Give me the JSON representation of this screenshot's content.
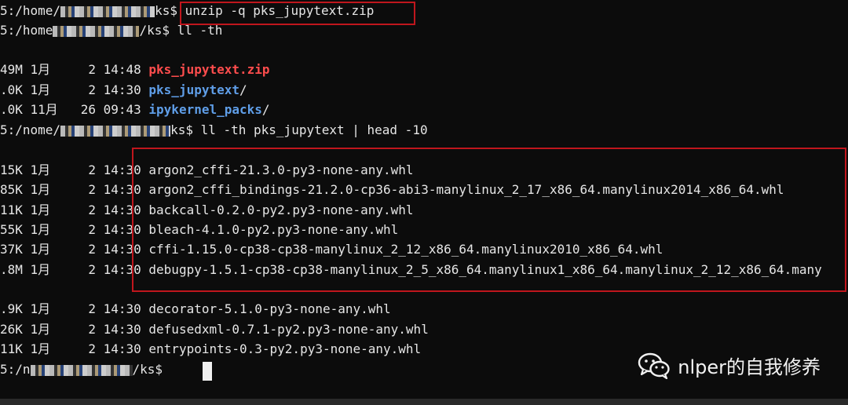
{
  "terminal": {
    "lines": [
      {
        "prefix": "5:/home/",
        "masked": "",
        "suffix": "ks$ ",
        "cmd": "unzip -q pks_jupytext.zip"
      },
      {
        "prefix": "5:/home",
        "masked": "",
        "suffix": "/ks$ ",
        "cmd": "ll -th"
      },
      {
        "blank": true
      },
      {
        "size": "49M",
        "month": "1月",
        "day": " 2",
        "time": "14:48",
        "name": "pks_jupytext.zip",
        "kind": "zip"
      },
      {
        "size": ".0K",
        "month": "1月",
        "day": " 2",
        "time": "14:30",
        "name": "pks_jupytext",
        "kind": "dir",
        "slash": "/"
      },
      {
        "size": ".0K",
        "month": "11月",
        "day": "26",
        "time": "09:43",
        "name": "ipykernel_packs",
        "kind": "dir",
        "slash": "/"
      },
      {
        "prefix": "5:/nome/",
        "masked": "",
        "suffix": "ks$ ",
        "cmd": "ll -th pks_jupytext | head -10"
      },
      {
        "blank": true
      },
      {
        "size": "15K",
        "month": "1月",
        "day": " 2",
        "time": "14:30",
        "name": "argon2_cffi-21.3.0-py3-none-any.whl"
      },
      {
        "size": "85K",
        "month": "1月",
        "day": " 2",
        "time": "14:30",
        "name": "argon2_cffi_bindings-21.2.0-cp36-abi3-manylinux_2_17_x86_64.manylinux2014_x86_64.whl"
      },
      {
        "size": "11K",
        "month": "1月",
        "day": " 2",
        "time": "14:30",
        "name": "backcall-0.2.0-py2.py3-none-any.whl"
      },
      {
        "size": "55K",
        "month": "1月",
        "day": " 2",
        "time": "14:30",
        "name": "bleach-4.1.0-py2.py3-none-any.whl"
      },
      {
        "size": "37K",
        "month": "1月",
        "day": " 2",
        "time": "14:30",
        "name": "cffi-1.15.0-cp38-cp38-manylinux_2_12_x86_64.manylinux2010_x86_64.whl"
      },
      {
        "size": ".8M",
        "month": "1月",
        "day": " 2",
        "time": "14:30",
        "name": "debugpy-1.5.1-cp38-cp38-manylinux_2_5_x86_64.manylinux1_x86_64.manylinux_2_12_x86_64.many"
      },
      {
        "blank": true
      },
      {
        "size": ".9K",
        "month": "1月",
        "day": " 2",
        "time": "14:30",
        "name": "decorator-5.1.0-py3-none-any.whl"
      },
      {
        "size": "26K",
        "month": "1月",
        "day": " 2",
        "time": "14:30",
        "name": "defusedxml-0.7.1-py2.py3-none-any.whl"
      },
      {
        "size": "11K",
        "month": "1月",
        "day": " 2",
        "time": "14:30",
        "name": "entrypoints-0.3-py2.py3-none-any.whl"
      },
      {
        "prefix": "5:/n",
        "masked": "",
        "suffix": "/ks$ ",
        "cmd": ""
      }
    ]
  },
  "watermark": {
    "text": "nlper的自我修养",
    "icon": "wechat-icon"
  },
  "colors": {
    "background": "#0c0c0c",
    "text": "#e6e6e6",
    "zip": "#ff4d4d",
    "dir": "#5f9ee8",
    "highlight_box": "#c0161d"
  }
}
